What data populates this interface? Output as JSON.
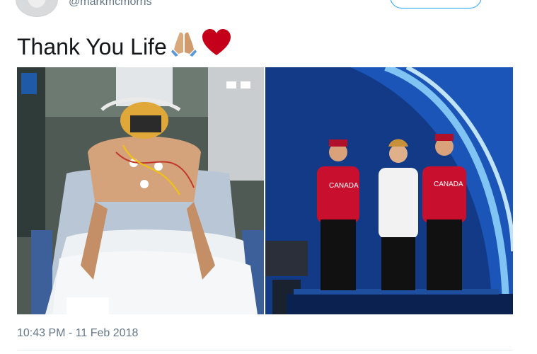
{
  "header": {
    "handle": "@markmcmorris",
    "avatar_icon": "profile-avatar"
  },
  "tweet": {
    "text": "Thank You Life",
    "emoji_1_icon": "folded-hands-icon",
    "emoji_2_icon": "red-heart-icon"
  },
  "media": {
    "left_photo": "hospital-bed-photo",
    "right_photo": "olympic-podium-photo",
    "jacket_text": "CANADA"
  },
  "footer": {
    "timestamp": "10:43 PM - 11 Feb 2018"
  },
  "colors": {
    "link": "#1da1f2",
    "muted": "#657786",
    "heart": "#c4001a"
  }
}
